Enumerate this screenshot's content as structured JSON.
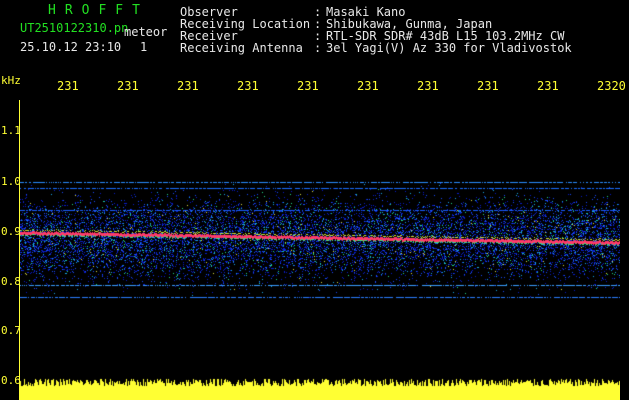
{
  "header": {
    "logo": "HROFFT",
    "filename": "UT2510122310.pn",
    "meteor_label": "meteor",
    "datetime": "25.10.12 23:10",
    "page_indicator": "1",
    "fields": [
      {
        "label": "Observer",
        "value": "Masaki Kano"
      },
      {
        "label": "Receiving Location",
        "value": "Shibukawa, Gunma, Japan"
      },
      {
        "label": "Receiver",
        "value": "RTL-SDR SDR# 43dB L15 103.2MHz CW"
      },
      {
        "label": "Receiving Antenna",
        "value": "3el Yagi(V) Az 330 for Vladivostok"
      }
    ]
  },
  "time_axis": {
    "labels": [
      "231",
      "231",
      "231",
      "231",
      "231",
      "231",
      "231",
      "231",
      "231",
      "2320"
    ]
  },
  "freq_axis": {
    "unit": "kHz",
    "labels": [
      "1.1",
      "1.0",
      "0.9",
      "0.8",
      "0.7",
      "0.6"
    ]
  },
  "colors": {
    "text_green": "#22e022",
    "text_white": "#e8e8e8",
    "axis_yellow": "#ffff33",
    "signal_red": "#ff3a6a",
    "noise_blue": "#1a3cff",
    "background": "#000000"
  }
}
